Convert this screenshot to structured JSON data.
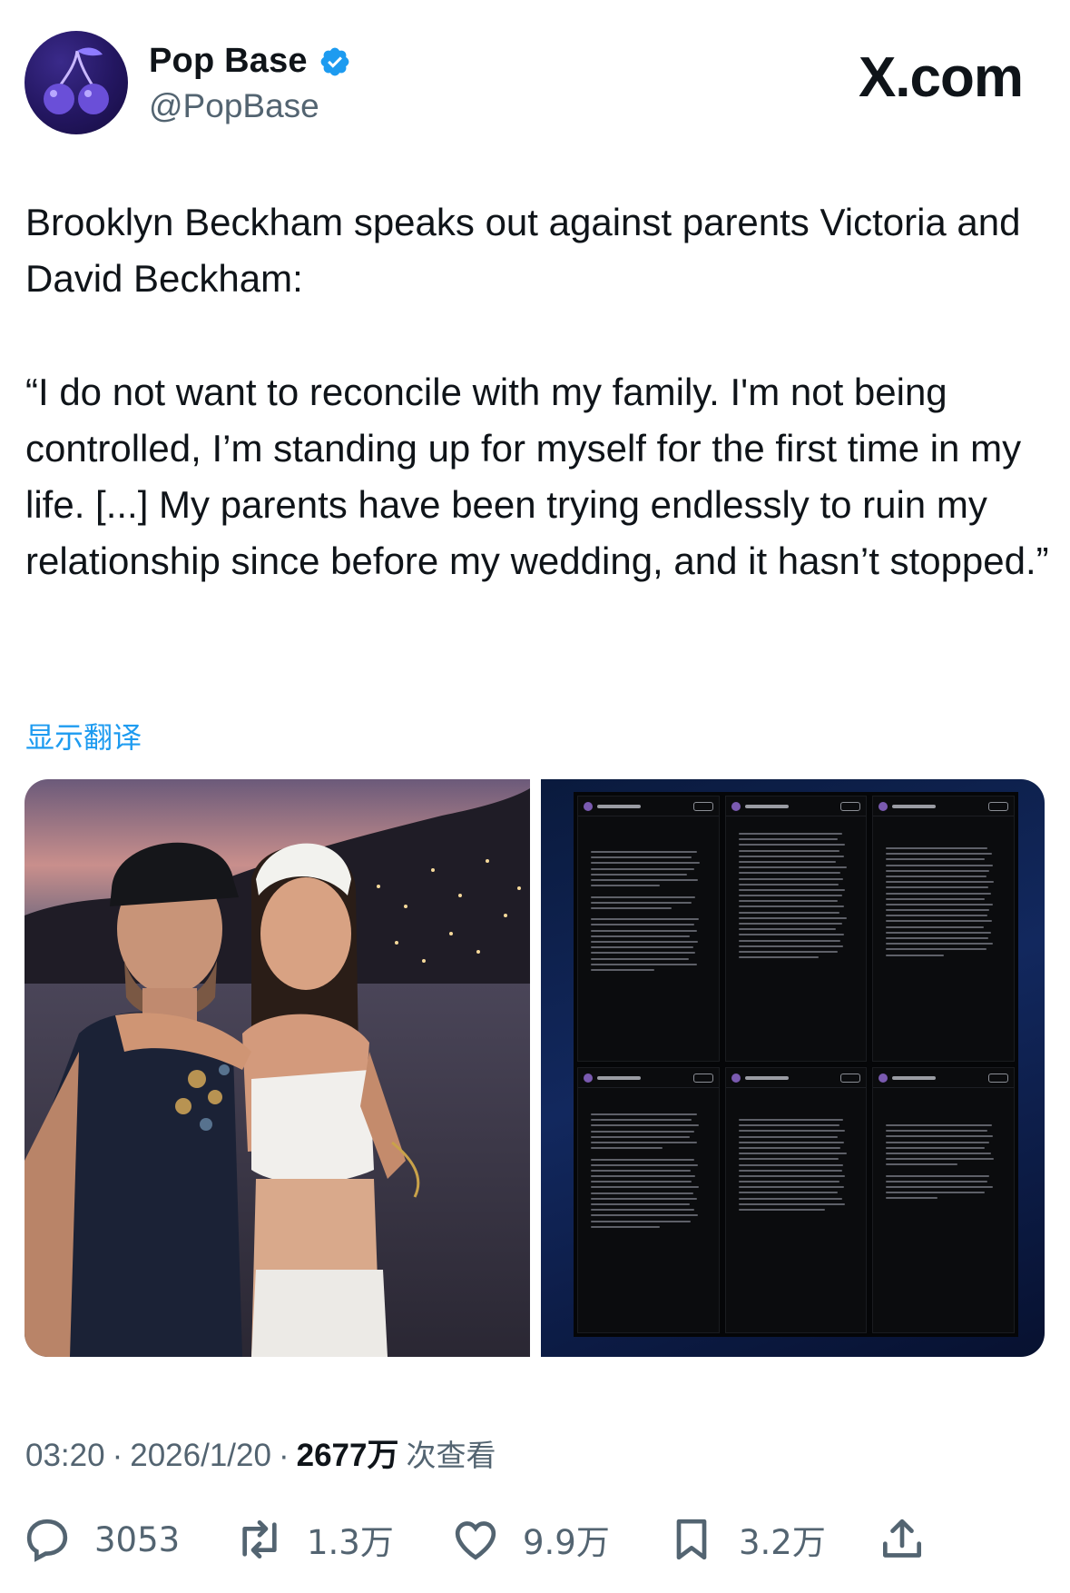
{
  "header": {
    "display_name": "Pop Base",
    "handle": "@PopBase",
    "brand": "X.com",
    "avatar_icon": "cherries-icon",
    "verified_icon": "verified-badge-icon",
    "verified_color": "#1d9bf0"
  },
  "tweet": {
    "line1": "Brooklyn Beckham speaks out against parents Victoria and David Beckham:",
    "line2": "“I do not want to reconcile with my family. I'm not being controlled, I’m standing up for myself for the first time in my life. [...] My parents have been trying endlessly to ruin my relationship since before my wedding, and it hasn’t stopped.”",
    "translate_label": "显示翻译"
  },
  "media": {
    "image1": "photo-couple",
    "image2": "instagram-story-screenshots"
  },
  "meta": {
    "time": "03:20",
    "date": "2026/1/20",
    "separator": "·",
    "views": "2677万",
    "views_label": "次查看"
  },
  "actions": {
    "replies": "3053",
    "reposts": "1.3万",
    "likes": "9.9万",
    "bookmarks": "3.2万"
  },
  "colors": {
    "text": "#0f1419",
    "secondary": "#536471",
    "link": "#1d9bf0"
  }
}
